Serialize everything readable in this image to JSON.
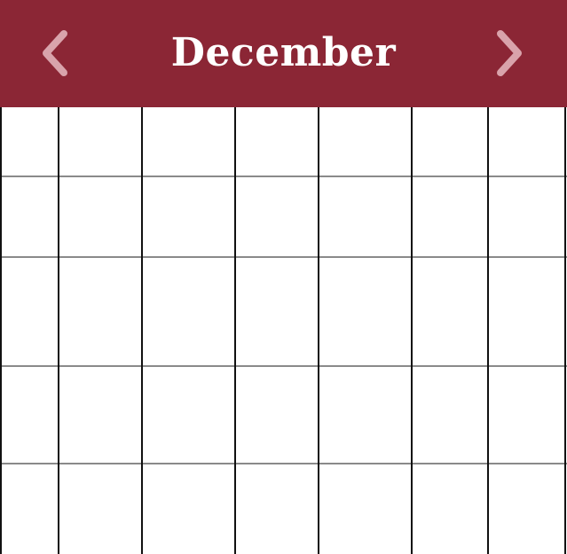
{
  "calendar": {
    "month": "December",
    "prev_icon": "chevron-left-icon",
    "next_icon": "chevron-right-icon",
    "colors": {
      "header_background": "#8b2635",
      "title_text": "#ffffff",
      "nav_icon": "#d9a3ab",
      "grid_vertical_line": "#111111",
      "grid_horizontal_line": "#8a8a8a",
      "cell_background": "#ffffff"
    },
    "columns": 7,
    "rows": 5
  }
}
